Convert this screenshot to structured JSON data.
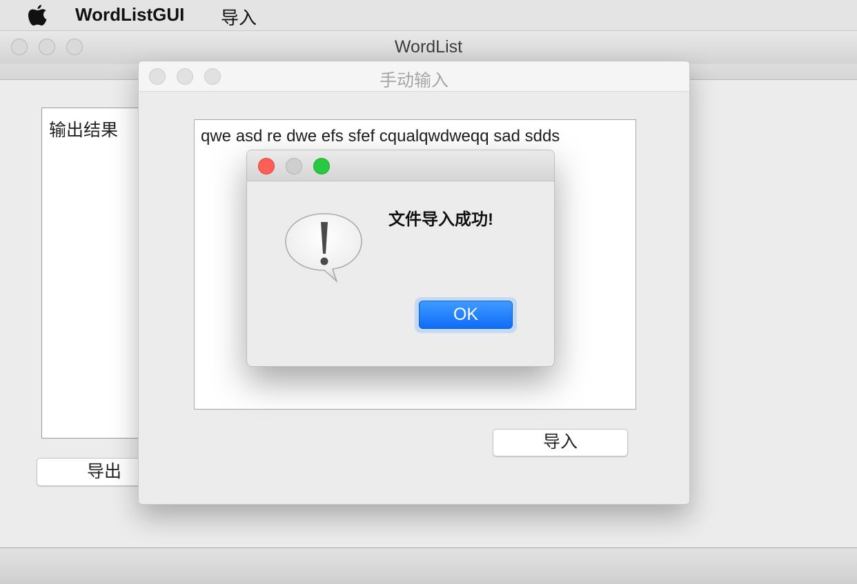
{
  "menubar": {
    "app_name": "WordListGUI",
    "menu_import": "导入"
  },
  "main_window": {
    "title": "WordList",
    "output_label": "输出结果",
    "export_button": "导出"
  },
  "input_window": {
    "title": "手动输入",
    "text_content": "qwe asd re dwe efs sfef cqualqwdweqq sad sdds",
    "import_button": "导入"
  },
  "alert": {
    "message": "文件导入成功!",
    "ok_button": "OK"
  },
  "colors": {
    "close": "#fe5f57",
    "zoom": "#28c840",
    "accent": "#106cf7",
    "background": "#ececec"
  },
  "icons": [
    "apple-icon",
    "warning-bubble-icon"
  ]
}
